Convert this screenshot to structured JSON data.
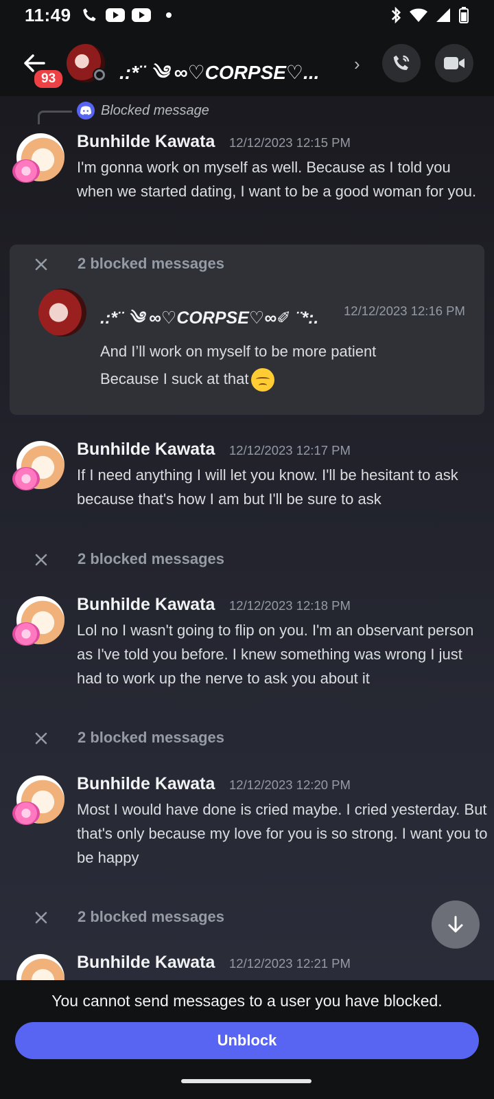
{
  "status_bar": {
    "time": "11:49"
  },
  "header": {
    "unread_badge": "93",
    "title": ".:*¨ ༄ ∞♡CORPSE♡...",
    "chevron": "›"
  },
  "reply": {
    "text": "Blocked message"
  },
  "messages": [
    {
      "author": "Bunhilde Kawata",
      "timestamp": "12/12/2023 12:15 PM",
      "text": "I'm gonna work on myself as well. Because as I told you when we started dating, I want to be a good woman for you."
    },
    {
      "author": "Bunhilde Kawata",
      "timestamp": "12/12/2023 12:17 PM",
      "text": "If I need anything I will let you know.  I'll be hesitant to ask because that's how I am but I'll be sure to ask"
    },
    {
      "author": "Bunhilde Kawata",
      "timestamp": "12/12/2023 12:18 PM",
      "text": "Lol no I wasn't going to flip on you. I'm an observant person as I've told you before. I knew something was wrong I just had to work up the nerve to ask you about it"
    },
    {
      "author": "Bunhilde Kawata",
      "timestamp": "12/12/2023 12:20 PM",
      "text": "Most I would have done is cried maybe. I cried yesterday. But that's only because my love for you is so strong. I want you to be happy"
    },
    {
      "author": "Bunhilde Kawata",
      "timestamp": "12/12/2023 12:21 PM",
      "text": ""
    }
  ],
  "blocked_groups": [
    {
      "label": "2 blocked messages"
    },
    {
      "label": "2 blocked messages"
    },
    {
      "label": "2 blocked messages"
    },
    {
      "label": "2 blocked messages"
    }
  ],
  "expanded_blocked": {
    "author": ".:*¨ ༄ ∞♡CORPSE♡∞✐ ¨*:.",
    "timestamp": "12/12/2023 12:16 PM",
    "line1": "And I’ll work on myself to be more patient",
    "line2": "Because I suck at that"
  },
  "footer": {
    "notice": "You cannot send messages to a user you have blocked.",
    "unblock_label": "Unblock"
  },
  "icons": {
    "back": "arrow-left-icon",
    "call": "phone-icon",
    "video": "video-camera-icon",
    "close": "close-icon",
    "scroll": "arrow-down-icon",
    "discord": "discord-icon"
  },
  "colors": {
    "accent": "#5865f2",
    "badge": "#ed4245",
    "background": "#1a1a1e"
  }
}
